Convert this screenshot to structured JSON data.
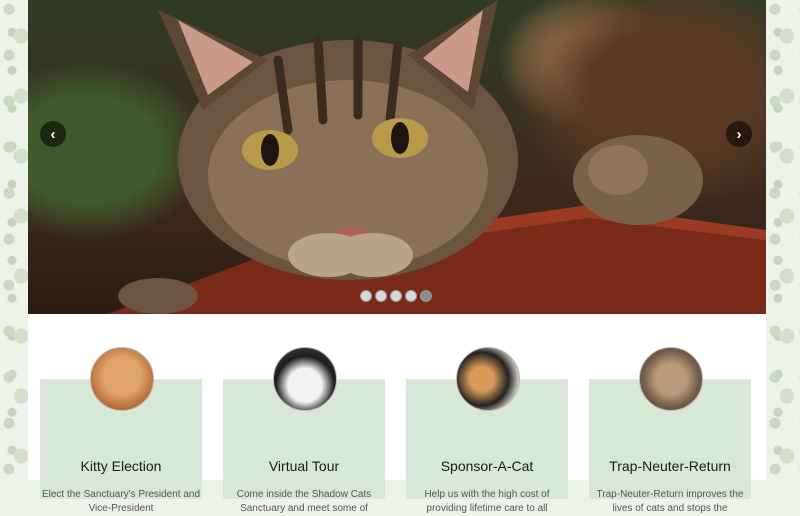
{
  "hero": {
    "prev_icon": "chevron-left-icon",
    "next_icon": "chevron-right-icon",
    "prev_glyph": "‹",
    "next_glyph": "›",
    "slide_count": 5,
    "active_slide": 5
  },
  "cards": [
    {
      "title": "Kitty Election",
      "description": "Elect the Sanctuary's President and Vice-President",
      "avatar": "orange-cat-photo"
    },
    {
      "title": "Virtual Tour",
      "description": "Come inside the Shadow Cats Sanctuary and meet some of",
      "avatar": "tuxedo-cat-photo"
    },
    {
      "title": "Sponsor-A-Cat",
      "description": "Help us with the high cost of providing lifetime care to all",
      "avatar": "calico-cat-photo"
    },
    {
      "title": "Trap-Neuter-Return",
      "description": "Trap-Neuter-Return improves the lives of cats and stops the",
      "avatar": "tabby-cat-photo"
    }
  ],
  "colors": {
    "card_bg": "#d7e8d6",
    "page_bg": "#ffffff",
    "pattern_bg": "#eef3ea"
  }
}
